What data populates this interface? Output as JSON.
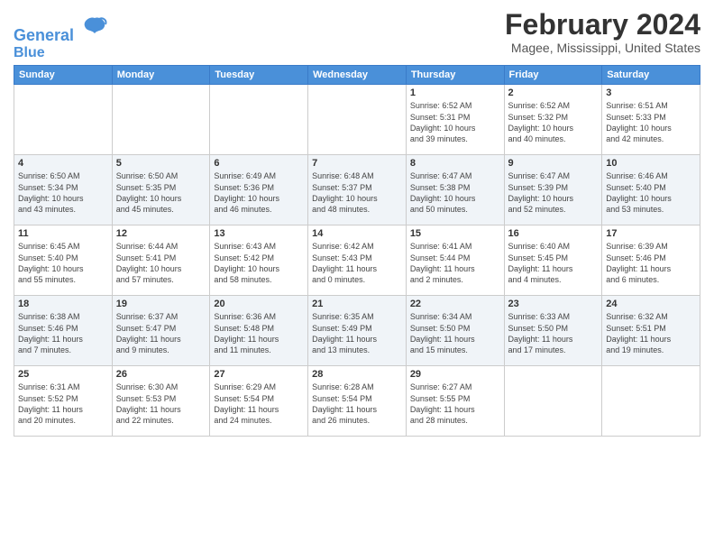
{
  "header": {
    "logo_line1": "General",
    "logo_line2": "Blue",
    "title": "February 2024",
    "subtitle": "Magee, Mississippi, United States"
  },
  "weekdays": [
    "Sunday",
    "Monday",
    "Tuesday",
    "Wednesday",
    "Thursday",
    "Friday",
    "Saturday"
  ],
  "weeks": [
    [
      {
        "day": "",
        "info": ""
      },
      {
        "day": "",
        "info": ""
      },
      {
        "day": "",
        "info": ""
      },
      {
        "day": "",
        "info": ""
      },
      {
        "day": "1",
        "info": "Sunrise: 6:52 AM\nSunset: 5:31 PM\nDaylight: 10 hours\nand 39 minutes."
      },
      {
        "day": "2",
        "info": "Sunrise: 6:52 AM\nSunset: 5:32 PM\nDaylight: 10 hours\nand 40 minutes."
      },
      {
        "day": "3",
        "info": "Sunrise: 6:51 AM\nSunset: 5:33 PM\nDaylight: 10 hours\nand 42 minutes."
      }
    ],
    [
      {
        "day": "4",
        "info": "Sunrise: 6:50 AM\nSunset: 5:34 PM\nDaylight: 10 hours\nand 43 minutes."
      },
      {
        "day": "5",
        "info": "Sunrise: 6:50 AM\nSunset: 5:35 PM\nDaylight: 10 hours\nand 45 minutes."
      },
      {
        "day": "6",
        "info": "Sunrise: 6:49 AM\nSunset: 5:36 PM\nDaylight: 10 hours\nand 46 minutes."
      },
      {
        "day": "7",
        "info": "Sunrise: 6:48 AM\nSunset: 5:37 PM\nDaylight: 10 hours\nand 48 minutes."
      },
      {
        "day": "8",
        "info": "Sunrise: 6:47 AM\nSunset: 5:38 PM\nDaylight: 10 hours\nand 50 minutes."
      },
      {
        "day": "9",
        "info": "Sunrise: 6:47 AM\nSunset: 5:39 PM\nDaylight: 10 hours\nand 52 minutes."
      },
      {
        "day": "10",
        "info": "Sunrise: 6:46 AM\nSunset: 5:40 PM\nDaylight: 10 hours\nand 53 minutes."
      }
    ],
    [
      {
        "day": "11",
        "info": "Sunrise: 6:45 AM\nSunset: 5:40 PM\nDaylight: 10 hours\nand 55 minutes."
      },
      {
        "day": "12",
        "info": "Sunrise: 6:44 AM\nSunset: 5:41 PM\nDaylight: 10 hours\nand 57 minutes."
      },
      {
        "day": "13",
        "info": "Sunrise: 6:43 AM\nSunset: 5:42 PM\nDaylight: 10 hours\nand 58 minutes."
      },
      {
        "day": "14",
        "info": "Sunrise: 6:42 AM\nSunset: 5:43 PM\nDaylight: 11 hours\nand 0 minutes."
      },
      {
        "day": "15",
        "info": "Sunrise: 6:41 AM\nSunset: 5:44 PM\nDaylight: 11 hours\nand 2 minutes."
      },
      {
        "day": "16",
        "info": "Sunrise: 6:40 AM\nSunset: 5:45 PM\nDaylight: 11 hours\nand 4 minutes."
      },
      {
        "day": "17",
        "info": "Sunrise: 6:39 AM\nSunset: 5:46 PM\nDaylight: 11 hours\nand 6 minutes."
      }
    ],
    [
      {
        "day": "18",
        "info": "Sunrise: 6:38 AM\nSunset: 5:46 PM\nDaylight: 11 hours\nand 7 minutes."
      },
      {
        "day": "19",
        "info": "Sunrise: 6:37 AM\nSunset: 5:47 PM\nDaylight: 11 hours\nand 9 minutes."
      },
      {
        "day": "20",
        "info": "Sunrise: 6:36 AM\nSunset: 5:48 PM\nDaylight: 11 hours\nand 11 minutes."
      },
      {
        "day": "21",
        "info": "Sunrise: 6:35 AM\nSunset: 5:49 PM\nDaylight: 11 hours\nand 13 minutes."
      },
      {
        "day": "22",
        "info": "Sunrise: 6:34 AM\nSunset: 5:50 PM\nDaylight: 11 hours\nand 15 minutes."
      },
      {
        "day": "23",
        "info": "Sunrise: 6:33 AM\nSunset: 5:50 PM\nDaylight: 11 hours\nand 17 minutes."
      },
      {
        "day": "24",
        "info": "Sunrise: 6:32 AM\nSunset: 5:51 PM\nDaylight: 11 hours\nand 19 minutes."
      }
    ],
    [
      {
        "day": "25",
        "info": "Sunrise: 6:31 AM\nSunset: 5:52 PM\nDaylight: 11 hours\nand 20 minutes."
      },
      {
        "day": "26",
        "info": "Sunrise: 6:30 AM\nSunset: 5:53 PM\nDaylight: 11 hours\nand 22 minutes."
      },
      {
        "day": "27",
        "info": "Sunrise: 6:29 AM\nSunset: 5:54 PM\nDaylight: 11 hours\nand 24 minutes."
      },
      {
        "day": "28",
        "info": "Sunrise: 6:28 AM\nSunset: 5:54 PM\nDaylight: 11 hours\nand 26 minutes."
      },
      {
        "day": "29",
        "info": "Sunrise: 6:27 AM\nSunset: 5:55 PM\nDaylight: 11 hours\nand 28 minutes."
      },
      {
        "day": "",
        "info": ""
      },
      {
        "day": "",
        "info": ""
      }
    ]
  ]
}
